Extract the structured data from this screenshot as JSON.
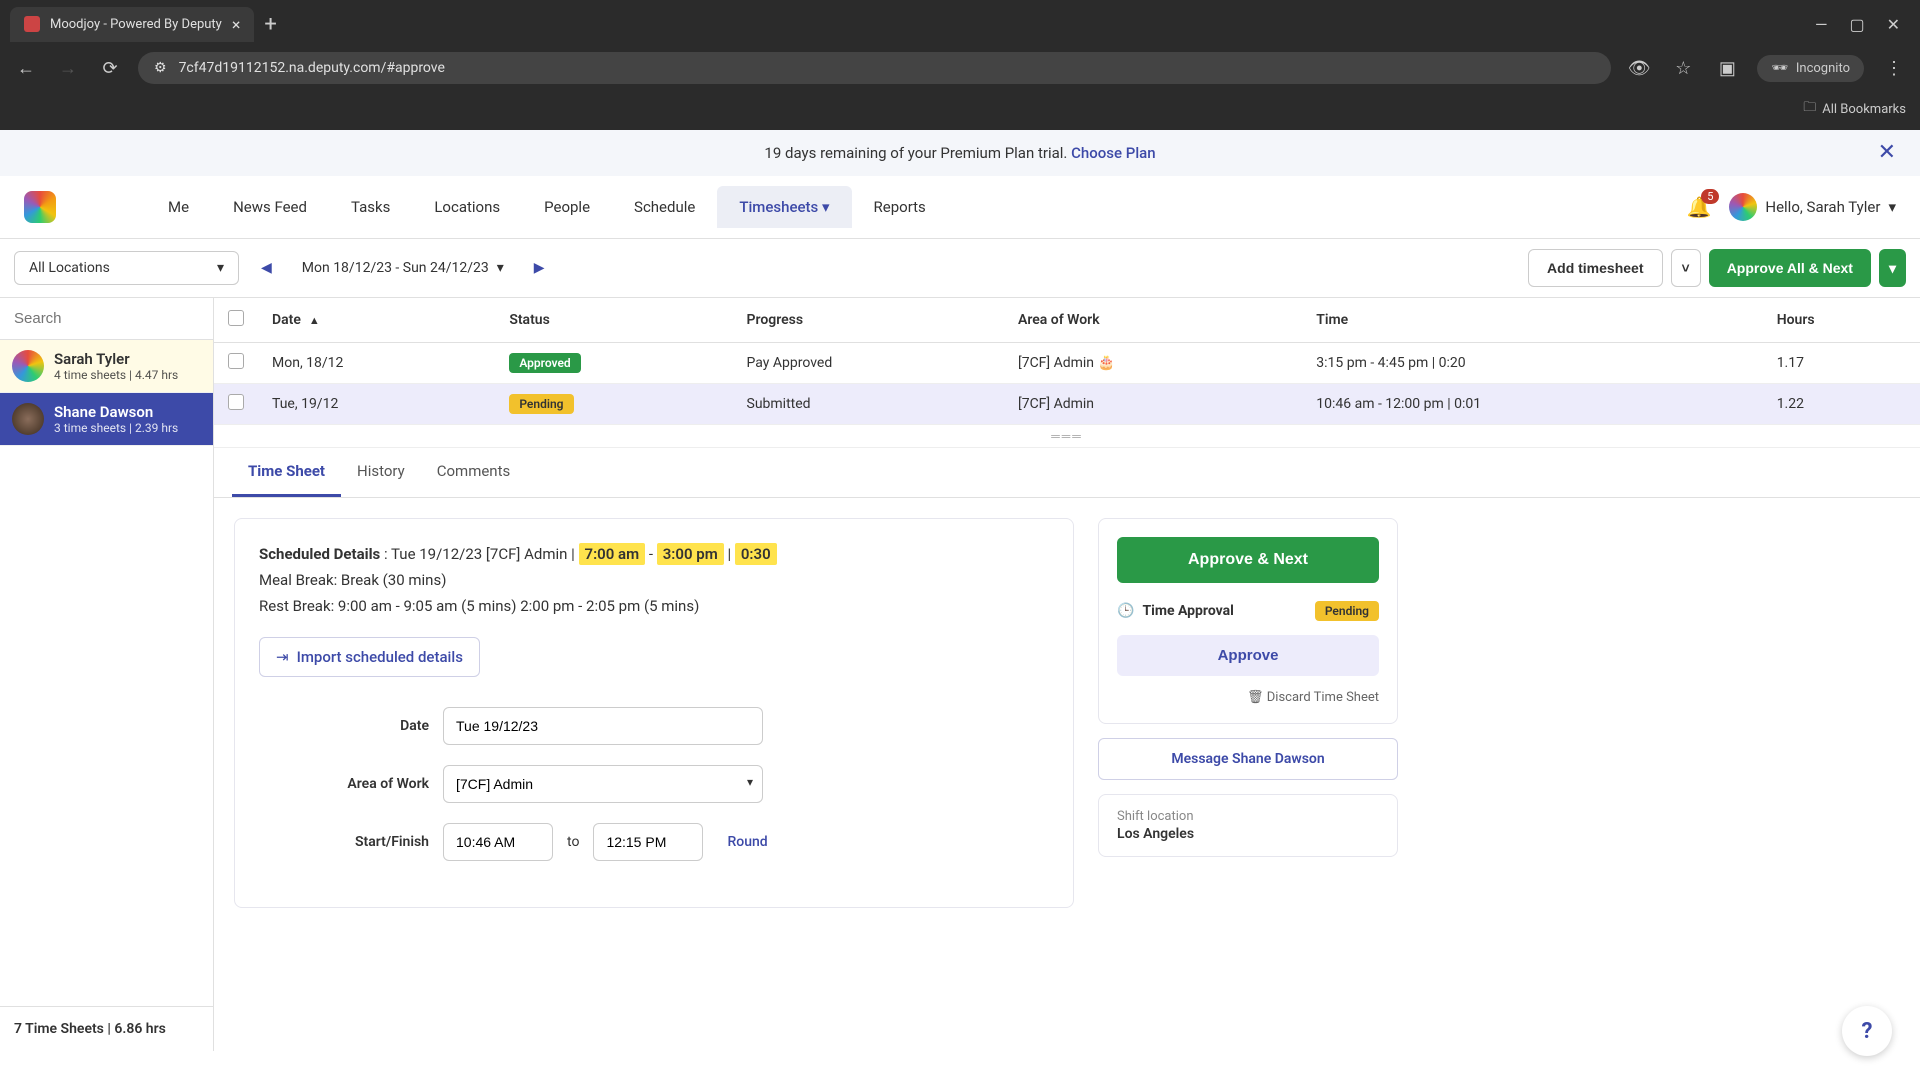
{
  "browser": {
    "tab_title": "Moodjoy - Powered By Deputy",
    "url": "7cf47d19112152.na.deputy.com/#approve",
    "incognito_label": "Incognito",
    "bookmarks_label": "All Bookmarks"
  },
  "trial": {
    "message": "19 days remaining of your Premium Plan trial. ",
    "link": "Choose Plan"
  },
  "nav": {
    "items": [
      "Me",
      "News Feed",
      "Tasks",
      "Locations",
      "People",
      "Schedule",
      "Timesheets",
      "Reports"
    ],
    "active_index": 6,
    "notifications": "5",
    "greeting": "Hello, Sarah Tyler"
  },
  "toolbar": {
    "location": "All Locations",
    "week_range": "Mon 18/12/23 - Sun 24/12/23",
    "add_timesheet": "Add timesheet",
    "approve_all_next": "Approve All & Next"
  },
  "sidebar": {
    "search_placeholder": "Search",
    "employees": [
      {
        "name": "Sarah Tyler",
        "meta": "4 time sheets | 4.47 hrs"
      },
      {
        "name": "Shane Dawson",
        "meta": "3 time sheets | 2.39 hrs"
      }
    ],
    "footer": "7 Time Sheets | 6.86 hrs"
  },
  "table": {
    "headers": {
      "date": "Date",
      "status": "Status",
      "progress": "Progress",
      "area": "Area of Work",
      "time": "Time",
      "hours": "Hours"
    },
    "rows": [
      {
        "date": "Mon, 18/12",
        "status": "Approved",
        "status_class": "badge-approved",
        "progress": "Pay Approved",
        "area": "[7CF] Admin 🎂",
        "time": "3:15 pm - 4:45 pm | 0:20",
        "hours": "1.17"
      },
      {
        "date": "Tue, 19/12",
        "status": "Pending",
        "status_class": "badge-pending",
        "progress": "Submitted",
        "area": "[7CF] Admin",
        "time": "10:46 am - 12:00 pm | 0:01",
        "hours": "1.22"
      }
    ]
  },
  "tabs": {
    "items": [
      "Time Sheet",
      "History",
      "Comments"
    ],
    "active_index": 0
  },
  "detail": {
    "scheduled_label": "Scheduled Details",
    "scheduled_text": " : Tue 19/12/23 [7CF] Admin | ",
    "hl_start": "7:00 am",
    "hl_sep1": " - ",
    "hl_end": "3:00 pm",
    "hl_sep2": " | ",
    "hl_break": "0:30",
    "meal_break": "Meal Break: Break (30 mins)",
    "rest_break": "Rest Break: 9:00 am - 9:05 am (5 mins) 2:00 pm - 2:05 pm (5 mins)",
    "import_label": "Import scheduled details",
    "form": {
      "date_label": "Date",
      "date_value": "Tue 19/12/23",
      "area_label": "Area of Work",
      "area_value": "[7CF] Admin",
      "startfinish_label": "Start/Finish",
      "start_value": "10:46 AM",
      "to": "to",
      "finish_value": "12:15 PM",
      "round": "Round"
    }
  },
  "approval": {
    "approve_next": "Approve & Next",
    "time_approval": "Time Approval",
    "status": "Pending",
    "approve": "Approve",
    "discard": "Discard Time Sheet",
    "message": "Message Shane Dawson",
    "shift_loc_label": "Shift location",
    "shift_loc_value": "Los Angeles"
  }
}
